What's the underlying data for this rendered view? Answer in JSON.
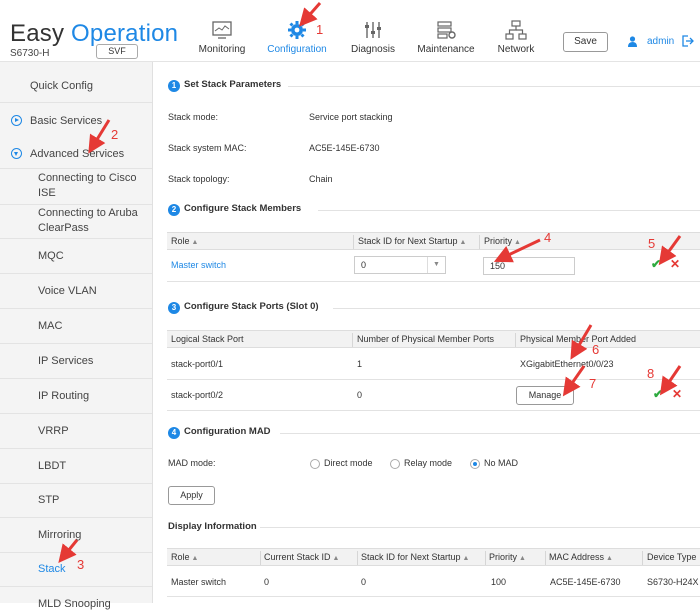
{
  "header": {
    "brand_easy": "Easy",
    "brand_operation": "Operation",
    "model": "S6730-H",
    "svf_label": "SVF",
    "nav": [
      {
        "label": "Monitoring",
        "icon": "monitor-icon"
      },
      {
        "label": "Configuration",
        "icon": "gear-icon"
      },
      {
        "label": "Diagnosis",
        "icon": "sliders-icon"
      },
      {
        "label": "Maintenance",
        "icon": "maintenance-icon"
      },
      {
        "label": "Network",
        "icon": "network-icon"
      }
    ],
    "save_label": "Save",
    "user": "admin"
  },
  "sidebar": {
    "quick_config": "Quick Config",
    "basic_services": "Basic Services",
    "advanced_services": "Advanced Services",
    "items": [
      "Connecting to Cisco ISE",
      "Connecting to Aruba ClearPass",
      "MQC",
      "Voice VLAN",
      "MAC",
      "IP Services",
      "IP Routing",
      "VRRP",
      "LBDT",
      "STP",
      "Mirroring",
      "Stack",
      "MLD Snooping"
    ]
  },
  "main": {
    "s1_num": "1",
    "s1_title": "Set Stack Parameters",
    "stack_mode_label": "Stack mode:",
    "stack_mode_value": "Service port stacking",
    "stack_mac_label": "Stack system MAC:",
    "stack_mac_value": "AC5E-145E-6730",
    "stack_topo_label": "Stack topology:",
    "stack_topo_value": "Chain",
    "s2_num": "2",
    "s2_title": "Configure Stack Members",
    "members_headers": [
      "Role",
      "Stack ID for Next Startup",
      "Priority"
    ],
    "member_role": "Master switch",
    "member_stack_id": "0",
    "member_priority": "150",
    "s3_num": "3",
    "s3_title": "Configure Stack Ports (Slot 0)",
    "ports_headers": [
      "Logical Stack Port",
      "Number of Physical Member Ports",
      "Physical Member Port Added"
    ],
    "port1_name": "stack-port0/1",
    "port1_count": "1",
    "port1_added": "XGigabitEthernet0/0/23",
    "port2_name": "stack-port0/2",
    "port2_count": "0",
    "manage_label": "Manage",
    "s4_num": "4",
    "s4_title": "Configuration MAD",
    "mad_label": "MAD mode:",
    "mad_options": [
      "Direct mode",
      "Relay mode",
      "No MAD"
    ],
    "mad_selected": "No MAD",
    "apply_label": "Apply",
    "display_title": "Display Information",
    "display_headers": [
      "Role",
      "Current Stack ID",
      "Stack ID for Next Startup",
      "Priority",
      "MAC Address",
      "Device Type"
    ],
    "display_row": [
      "Master switch",
      "0",
      "0",
      "100",
      "AC5E-145E-6730",
      "S6730-H24X"
    ]
  },
  "annotations": [
    "1",
    "2",
    "3",
    "4",
    "5",
    "6",
    "7",
    "8"
  ],
  "colors": {
    "accent": "#1e88e5",
    "arrow": "#e53935",
    "ok": "#2eaa3f"
  }
}
